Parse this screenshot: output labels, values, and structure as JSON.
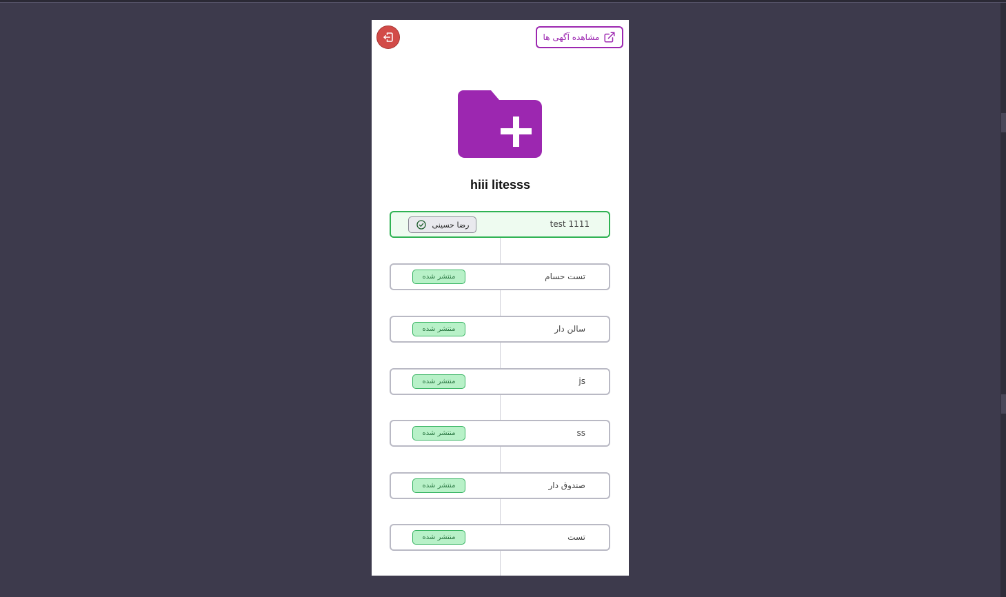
{
  "header": {
    "view_ads_label": "مشاهده آگهی ها",
    "view_ads_icon": "external-link-icon",
    "logout_icon": "logout-icon"
  },
  "main": {
    "folder_icon": "folder-plus-icon",
    "title": "hiii litesss"
  },
  "colors": {
    "accent": "#9c27b0",
    "logout": "#d24b48",
    "active_border": "#2fb253",
    "badge_bg": "#b8f1c8"
  },
  "items": [
    {
      "title": "test 1111",
      "status": "active",
      "user": "رضا حسینی",
      "user_icon": "check-circle-icon"
    },
    {
      "title": "تست حسام",
      "badge": "منتشر شده"
    },
    {
      "title": "سالن دار",
      "badge": "منتشر شده"
    },
    {
      "title": "js",
      "badge": "منتشر شده"
    },
    {
      "title": "ss",
      "badge": "منتشر شده"
    },
    {
      "title": "صندوق دار",
      "badge": "منتشر شده"
    },
    {
      "title": "تست",
      "badge": "منتشر شده"
    }
  ]
}
